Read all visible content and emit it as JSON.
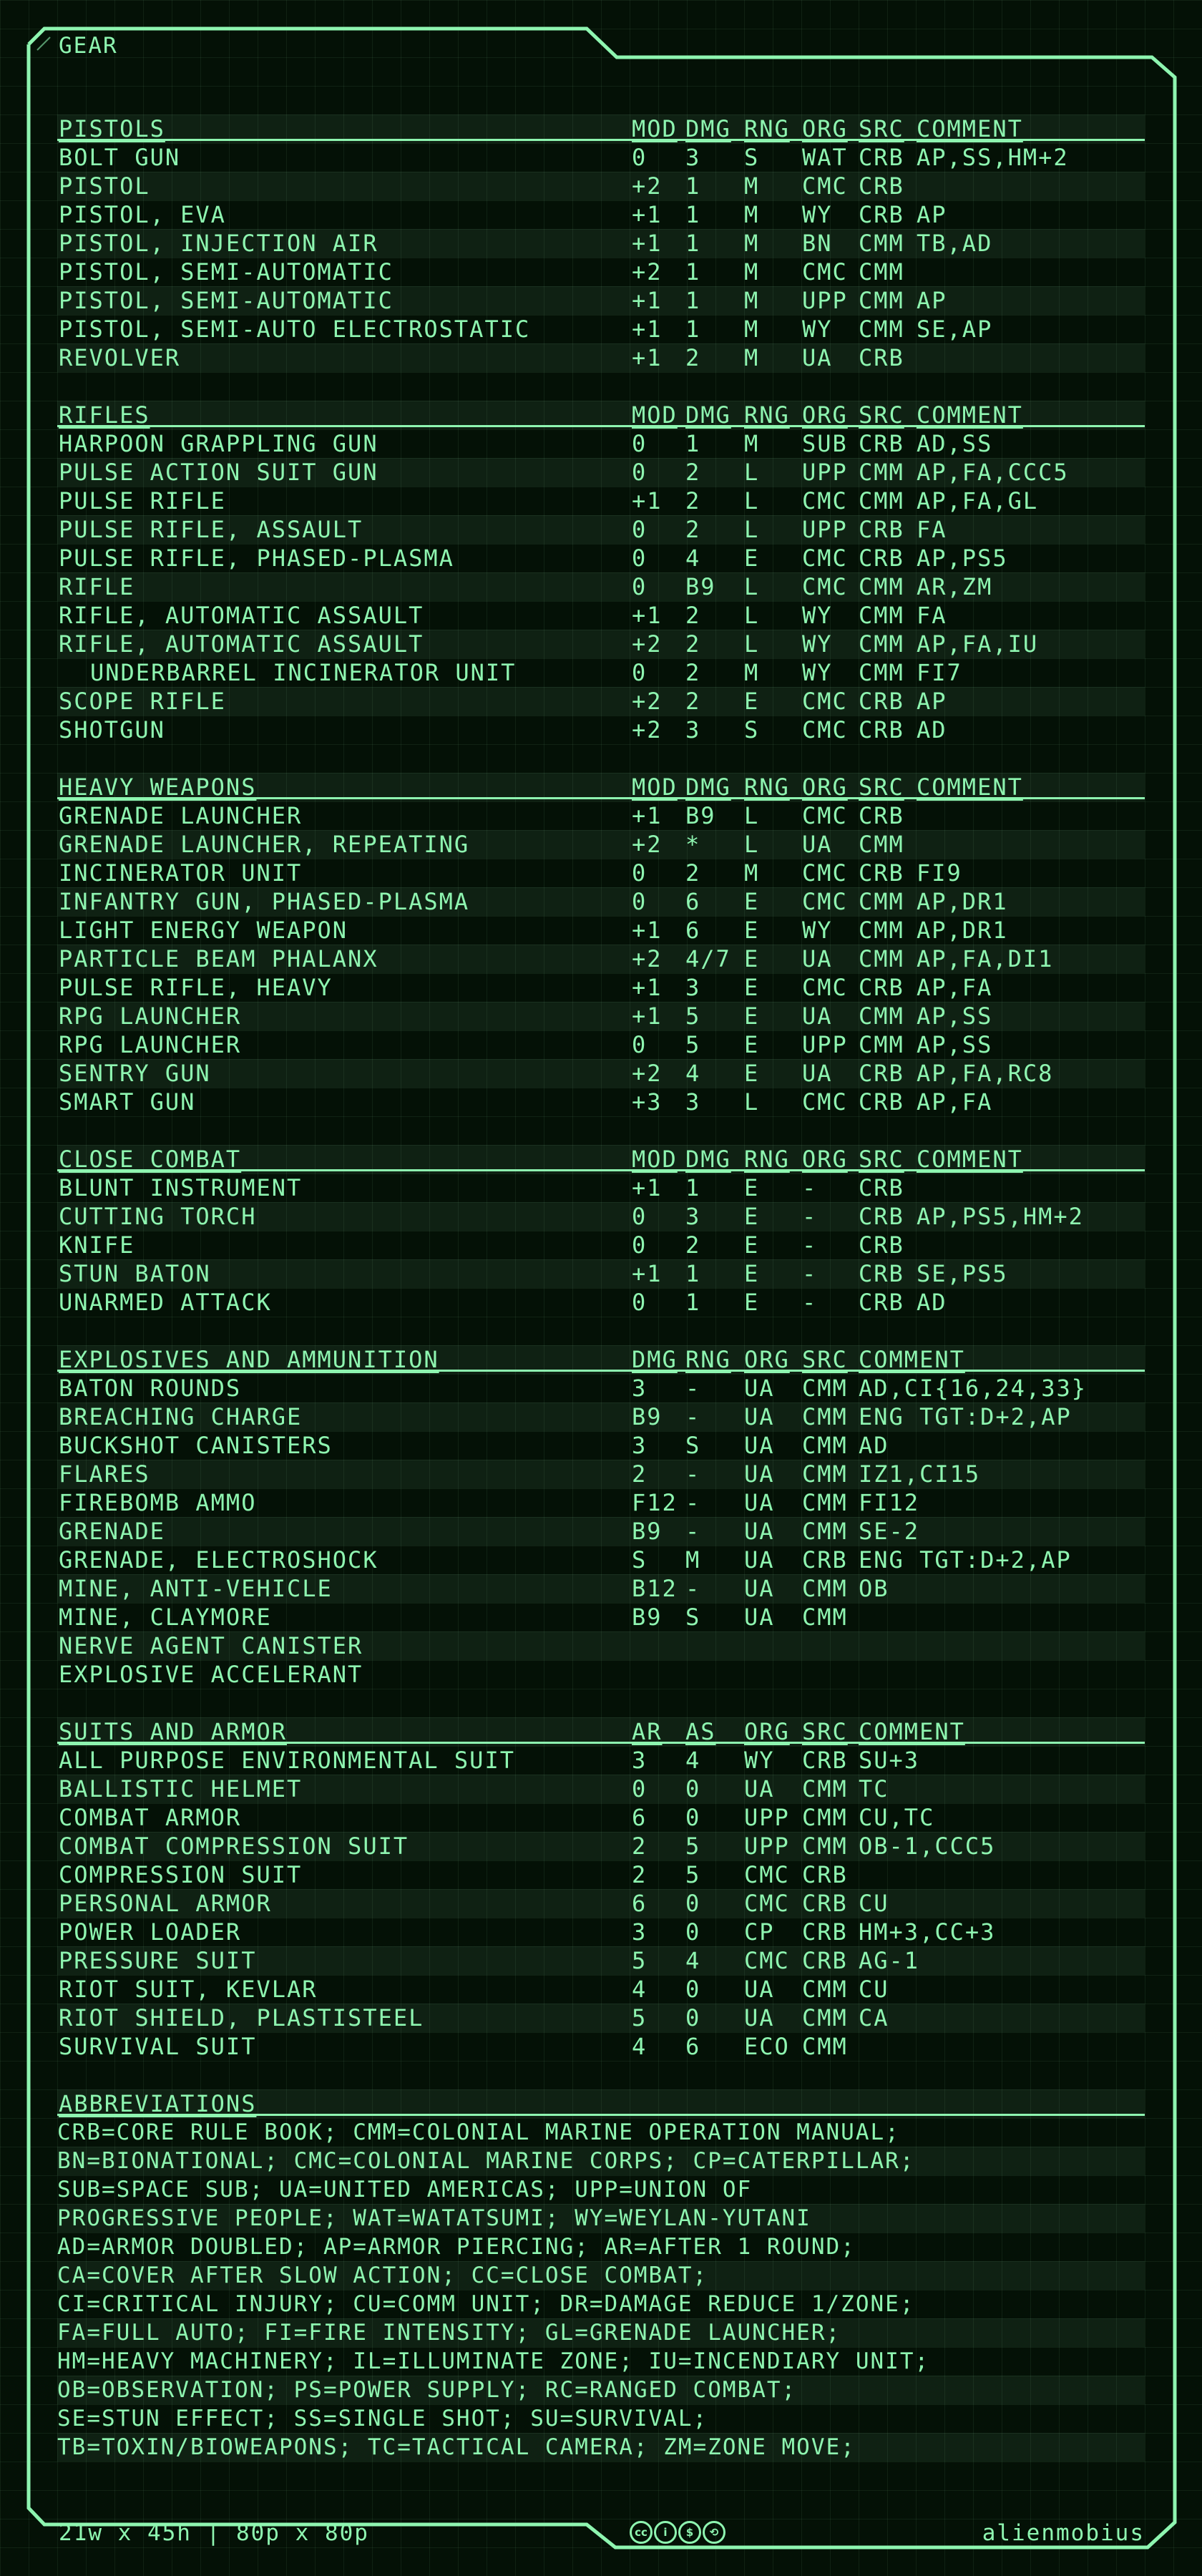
{
  "title": "GEAR",
  "colors": {
    "background": "#041106",
    "accent": "#8ef5b0"
  },
  "weapon_sections": [
    {
      "name": "PISTOLS",
      "headers": [
        "MOD",
        "DMG",
        "RNG",
        "ORG",
        "SRC",
        "COMMENT"
      ],
      "rows": [
        {
          "name": "BOLT GUN",
          "mod": "0",
          "dmg": "3",
          "rng": "S",
          "org": "WAT",
          "src": "CRB",
          "comment": "AP,SS,HM+2"
        },
        {
          "name": "PISTOL",
          "mod": "+2",
          "dmg": "1",
          "rng": "M",
          "org": "CMC",
          "src": "CRB",
          "comment": ""
        },
        {
          "name": "PISTOL, EVA",
          "mod": "+1",
          "dmg": "1",
          "rng": "M",
          "org": "WY",
          "src": "CRB",
          "comment": "AP"
        },
        {
          "name": "PISTOL, INJECTION AIR",
          "mod": "+1",
          "dmg": "1",
          "rng": "M",
          "org": "BN",
          "src": "CMM",
          "comment": "TB,AD"
        },
        {
          "name": "PISTOL, SEMI-AUTOMATIC",
          "mod": "+2",
          "dmg": "1",
          "rng": "M",
          "org": "CMC",
          "src": "CMM",
          "comment": ""
        },
        {
          "name": "PISTOL, SEMI-AUTOMATIC",
          "mod": "+1",
          "dmg": "1",
          "rng": "M",
          "org": "UPP",
          "src": "CMM",
          "comment": "AP"
        },
        {
          "name": "PISTOL, SEMI-AUTO ELECTROSTATIC",
          "mod": "+1",
          "dmg": "1",
          "rng": "M",
          "org": "WY",
          "src": "CMM",
          "comment": "SE,AP"
        },
        {
          "name": "REVOLVER",
          "mod": "+1",
          "dmg": "2",
          "rng": "M",
          "org": "UA",
          "src": "CRB",
          "comment": ""
        }
      ]
    },
    {
      "name": "RIFLES",
      "headers": [
        "MOD",
        "DMG",
        "RNG",
        "ORG",
        "SRC",
        "COMMENT"
      ],
      "rows": [
        {
          "name": "HARPOON GRAPPLING GUN",
          "mod": "0",
          "dmg": "1",
          "rng": "M",
          "org": "SUB",
          "src": "CRB",
          "comment": "AD,SS"
        },
        {
          "name": "PULSE ACTION SUIT GUN",
          "mod": "0",
          "dmg": "2",
          "rng": "L",
          "org": "UPP",
          "src": "CMM",
          "comment": "AP,FA,CCC5"
        },
        {
          "name": "PULSE RIFLE",
          "mod": "+1",
          "dmg": "2",
          "rng": "L",
          "org": "CMC",
          "src": "CMM",
          "comment": "AP,FA,GL"
        },
        {
          "name": "PULSE RIFLE, ASSAULT",
          "mod": "0",
          "dmg": "2",
          "rng": "L",
          "org": "UPP",
          "src": "CRB",
          "comment": "FA"
        },
        {
          "name": "PULSE RIFLE, PHASED-PLASMA",
          "mod": "0",
          "dmg": "4",
          "rng": "E",
          "org": "CMC",
          "src": "CRB",
          "comment": "AP,PS5"
        },
        {
          "name": "RIFLE",
          "mod": "0",
          "dmg": "B9",
          "rng": "L",
          "org": "CMC",
          "src": "CMM",
          "comment": "AR,ZM"
        },
        {
          "name": "RIFLE, AUTOMATIC ASSAULT",
          "mod": "+1",
          "dmg": "2",
          "rng": "L",
          "org": "WY",
          "src": "CMM",
          "comment": "FA"
        },
        {
          "name": "RIFLE, AUTOMATIC ASSAULT",
          "mod": "+2",
          "dmg": "2",
          "rng": "L",
          "org": "WY",
          "src": "CMM",
          "comment": "AP,FA,IU"
        },
        {
          "name": "UNDERBARREL INCINERATOR UNIT",
          "mod": "0",
          "dmg": "2",
          "rng": "M",
          "org": "WY",
          "src": "CMM",
          "comment": "FI7",
          "indent": true
        },
        {
          "name": "SCOPE RIFLE",
          "mod": "+2",
          "dmg": "2",
          "rng": "E",
          "org": "CMC",
          "src": "CRB",
          "comment": "AP"
        },
        {
          "name": "SHOTGUN",
          "mod": "+2",
          "dmg": "3",
          "rng": "S",
          "org": "CMC",
          "src": "CRB",
          "comment": "AD"
        }
      ]
    },
    {
      "name": "HEAVY WEAPONS",
      "headers": [
        "MOD",
        "DMG",
        "RNG",
        "ORG",
        "SRC",
        "COMMENT"
      ],
      "rows": [
        {
          "name": "GRENADE LAUNCHER",
          "mod": "+1",
          "dmg": "B9",
          "rng": "L",
          "org": "CMC",
          "src": "CRB",
          "comment": ""
        },
        {
          "name": "GRENADE LAUNCHER, REPEATING",
          "mod": "+2",
          "dmg": "*",
          "rng": "L",
          "org": "UA",
          "src": "CMM",
          "comment": ""
        },
        {
          "name": "INCINERATOR UNIT",
          "mod": "0",
          "dmg": "2",
          "rng": "M",
          "org": "CMC",
          "src": "CRB",
          "comment": "FI9"
        },
        {
          "name": "INFANTRY GUN, PHASED-PLASMA",
          "mod": "0",
          "dmg": "6",
          "rng": "E",
          "org": "CMC",
          "src": "CMM",
          "comment": "AP,DR1"
        },
        {
          "name": "LIGHT ENERGY WEAPON",
          "mod": "+1",
          "dmg": "6",
          "rng": "E",
          "org": "WY",
          "src": "CMM",
          "comment": "AP,DR1"
        },
        {
          "name": "PARTICLE BEAM PHALANX",
          "mod": "+2",
          "dmg": "4/7",
          "rng": "E",
          "org": "UA",
          "src": "CMM",
          "comment": "AP,FA,DI1"
        },
        {
          "name": "PULSE RIFLE, HEAVY",
          "mod": "+1",
          "dmg": "3",
          "rng": "E",
          "org": "CMC",
          "src": "CRB",
          "comment": "AP,FA"
        },
        {
          "name": "RPG LAUNCHER",
          "mod": "+1",
          "dmg": "5",
          "rng": "E",
          "org": "UA",
          "src": "CMM",
          "comment": "AP,SS"
        },
        {
          "name": "RPG LAUNCHER",
          "mod": "0",
          "dmg": "5",
          "rng": "E",
          "org": "UPP",
          "src": "CMM",
          "comment": "AP,SS"
        },
        {
          "name": "SENTRY GUN",
          "mod": "+2",
          "dmg": "4",
          "rng": "E",
          "org": "UA",
          "src": "CRB",
          "comment": "AP,FA,RC8"
        },
        {
          "name": "SMART GUN",
          "mod": "+3",
          "dmg": "3",
          "rng": "L",
          "org": "CMC",
          "src": "CRB",
          "comment": "AP,FA"
        }
      ]
    },
    {
      "name": "CLOSE COMBAT",
      "headers": [
        "MOD",
        "DMG",
        "RNG",
        "ORG",
        "SRC",
        "COMMENT"
      ],
      "rows": [
        {
          "name": "BLUNT INSTRUMENT",
          "mod": "+1",
          "dmg": "1",
          "rng": "E",
          "org": "-",
          "src": "CRB",
          "comment": ""
        },
        {
          "name": "CUTTING TORCH",
          "mod": "0",
          "dmg": "3",
          "rng": "E",
          "org": "-",
          "src": "CRB",
          "comment": "AP,PS5,HM+2"
        },
        {
          "name": "KNIFE",
          "mod": "0",
          "dmg": "2",
          "rng": "E",
          "org": "-",
          "src": "CRB",
          "comment": ""
        },
        {
          "name": "STUN BATON",
          "mod": "+1",
          "dmg": "1",
          "rng": "E",
          "org": "-",
          "src": "CRB",
          "comment": "SE,PS5"
        },
        {
          "name": "UNARMED ATTACK",
          "mod": "0",
          "dmg": "1",
          "rng": "E",
          "org": "-",
          "src": "CRB",
          "comment": "AD"
        }
      ]
    }
  ],
  "explosives": {
    "name": "EXPLOSIVES AND AMMUNITION",
    "headers": [
      "DMG",
      "RNG",
      "ORG",
      "SRC",
      "COMMENT"
    ],
    "rows": [
      {
        "name": "BATON ROUNDS",
        "dmg": "3",
        "rng": "-",
        "org": "UA",
        "src": "CMM",
        "comment": "AD,CI{16,24,33}"
      },
      {
        "name": "BREACHING CHARGE",
        "dmg": "B9",
        "rng": "-",
        "org": "UA",
        "src": "CMM",
        "comment": "ENG TGT:D+2,AP"
      },
      {
        "name": "BUCKSHOT CANISTERS",
        "dmg": "3",
        "rng": "S",
        "org": "UA",
        "src": "CMM",
        "comment": "AD"
      },
      {
        "name": "FLARES",
        "dmg": "2",
        "rng": "-",
        "org": "UA",
        "src": "CMM",
        "comment": "IZ1,CI15"
      },
      {
        "name": "FIREBOMB AMMO",
        "dmg": "F12",
        "rng": "-",
        "org": "UA",
        "src": "CMM",
        "comment": "FI12"
      },
      {
        "name": "GRENADE",
        "dmg": "B9",
        "rng": "-",
        "org": "UA",
        "src": "CMM",
        "comment": "SE-2"
      },
      {
        "name": "GRENADE, ELECTROSHOCK",
        "dmg": "S",
        "rng": "M",
        "org": "UA",
        "src": "CRB",
        "comment": "ENG TGT:D+2,AP"
      },
      {
        "name": "MINE, ANTI-VEHICLE",
        "dmg": "B12",
        "rng": "-",
        "org": "UA",
        "src": "CMM",
        "comment": "OB"
      },
      {
        "name": "MINE, CLAYMORE",
        "dmg": "B9",
        "rng": "S",
        "org": "UA",
        "src": "CMM",
        "comment": ""
      },
      {
        "name": "NERVE AGENT CANISTER",
        "dmg": "",
        "rng": "",
        "org": "",
        "src": "",
        "comment": ""
      },
      {
        "name": "EXPLOSIVE ACCELERANT",
        "dmg": "",
        "rng": "",
        "org": "",
        "src": "",
        "comment": ""
      }
    ]
  },
  "armor": {
    "name": "SUITS AND ARMOR",
    "headers": [
      "AR",
      "AS",
      "ORG",
      "SRC",
      "COMMENT"
    ],
    "rows": [
      {
        "name": "ALL PURPOSE ENVIRONMENTAL SUIT",
        "ar": "3",
        "as": "4",
        "org": "WY",
        "src": "CRB",
        "comment": "SU+3"
      },
      {
        "name": "BALLISTIC HELMET",
        "ar": "0",
        "as": "0",
        "org": "UA",
        "src": "CMM",
        "comment": "TC"
      },
      {
        "name": "COMBAT ARMOR",
        "ar": "6",
        "as": "0",
        "org": "UPP",
        "src": "CMM",
        "comment": "CU,TC"
      },
      {
        "name": "COMBAT COMPRESSION SUIT",
        "ar": "2",
        "as": "5",
        "org": "UPP",
        "src": "CMM",
        "comment": "OB-1,CCC5"
      },
      {
        "name": "COMPRESSION SUIT",
        "ar": "2",
        "as": "5",
        "org": "CMC",
        "src": "CRB",
        "comment": ""
      },
      {
        "name": "PERSONAL ARMOR",
        "ar": "6",
        "as": "0",
        "org": "CMC",
        "src": "CRB",
        "comment": "CU"
      },
      {
        "name": "POWER LOADER",
        "ar": "3",
        "as": "0",
        "org": "CP",
        "src": "CRB",
        "comment": "HM+3,CC+3"
      },
      {
        "name": "PRESSURE SUIT",
        "ar": "5",
        "as": "4",
        "org": "CMC",
        "src": "CRB",
        "comment": "AG-1"
      },
      {
        "name": "RIOT SUIT, KEVLAR",
        "ar": "4",
        "as": "0",
        "org": "UA",
        "src": "CMM",
        "comment": "CU"
      },
      {
        "name": "RIOT SHIELD, PLASTISTEEL",
        "ar": "5",
        "as": "0",
        "org": "UA",
        "src": "CMM",
        "comment": "CA"
      },
      {
        "name": "SURVIVAL SUIT",
        "ar": "4",
        "as": "6",
        "org": "ECO",
        "src": "CMM",
        "comment": ""
      }
    ]
  },
  "abbreviations": {
    "name": "ABBREVIATIONS",
    "lines": [
      "CRB=CORE RULE BOOK; CMM=COLONIAL MARINE OPERATION MANUAL;",
      "BN=BIONATIONAL; CMC=COLONIAL MARINE CORPS; CP=CATERPILLAR;",
      "SUB=SPACE SUB; UA=UNITED AMERICAS; UPP=UNION OF",
      "PROGRESSIVE PEOPLE; WAT=WATATSUMI; WY=WEYLAN-YUTANI",
      "AD=ARMOR DOUBLED; AP=ARMOR PIERCING; AR=AFTER 1 ROUND;",
      "CA=COVER AFTER SLOW ACTION; CC=CLOSE COMBAT;",
      "CI=CRITICAL INJURY; CU=COMM UNIT; DR=DAMAGE REDUCE 1/ZONE;",
      "FA=FULL AUTO; FI=FIRE INTENSITY; GL=GRENADE LAUNCHER;",
      "HM=HEAVY MACHINERY; IL=ILLUMINATE ZONE; IU=INCENDIARY UNIT;",
      "OB=OBSERVATION; PS=POWER SUPPLY; RC=RANGED COMBAT;",
      "SE=STUN EFFECT; SS=SINGLE SHOT; SU=SURVIVAL;",
      "TB=TOXIN/BIOWEAPONS; TC=TACTICAL CAMERA; ZM=ZONE MOVE;"
    ]
  },
  "footer": {
    "size_text": "21w x 45h | 80p x 80p",
    "author": "alienmobius",
    "license_icons": [
      "cc-icon",
      "by-icon",
      "nc-icon",
      "sa-icon"
    ],
    "license_glyphs": [
      "cc",
      "i",
      "$",
      "⟲"
    ]
  }
}
